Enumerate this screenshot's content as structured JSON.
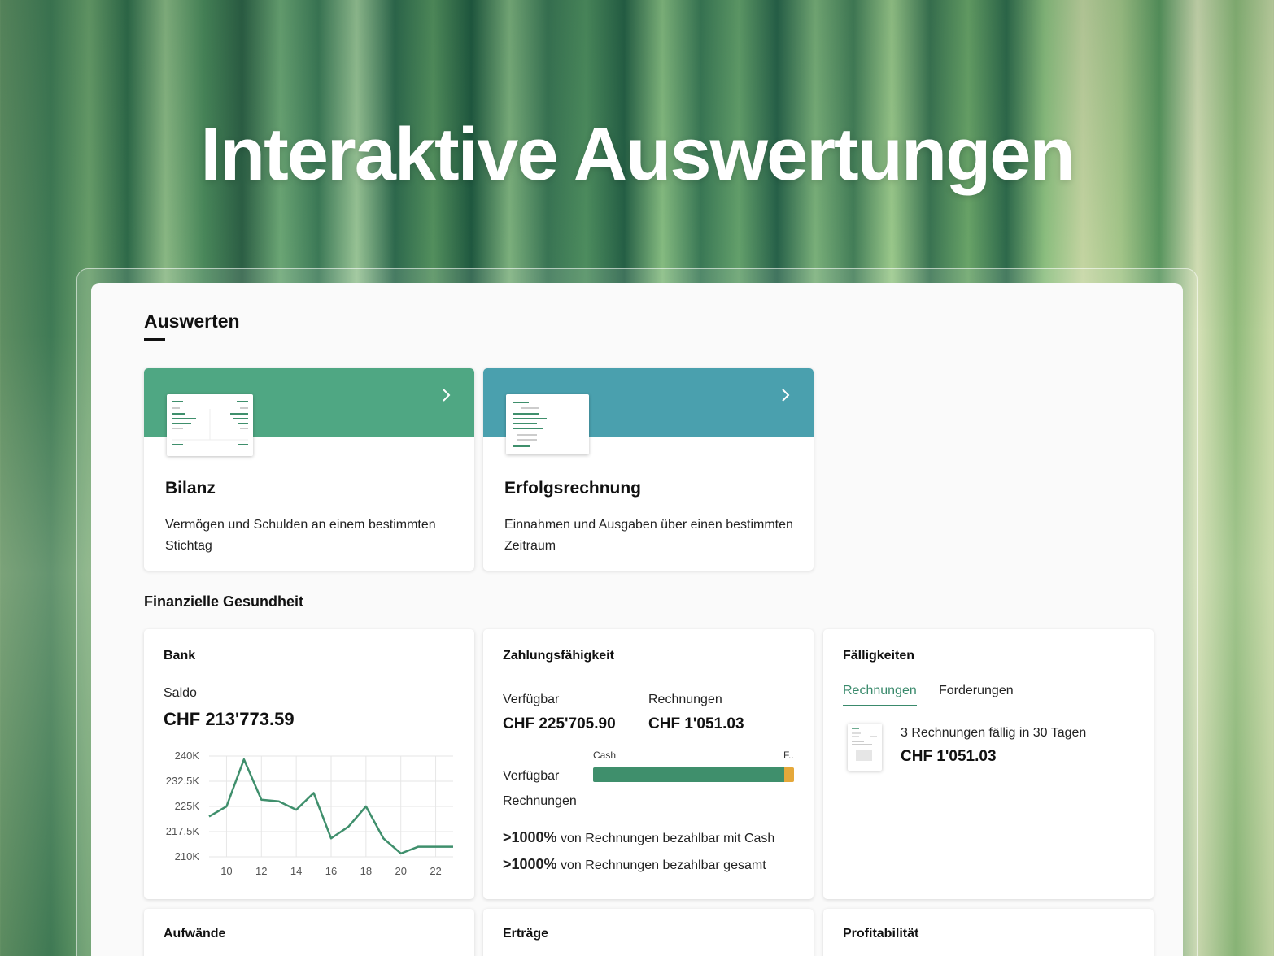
{
  "hero": {
    "title": "Interaktive Auswertungen"
  },
  "main": {
    "section_title": "Auswerten",
    "reports": [
      {
        "title": "Bilanz",
        "description": "Vermögen und Schulden an einem bestimmten Stichtag",
        "band_color": "#4fa783"
      },
      {
        "title": "Erfolgsrechnung",
        "description": "Einnahmen und Ausgaben über einen bestimmten Zeitraum",
        "band_color": "#4aa0ae"
      }
    ],
    "health_title": "Finanzielle Gesundheit"
  },
  "bank": {
    "title": "Bank",
    "saldo_label": "Saldo",
    "saldo_value": "CHF 213'773.59"
  },
  "chart_data": {
    "type": "line",
    "x": [
      9,
      10,
      11,
      12,
      13,
      14,
      15,
      16,
      17,
      18,
      19,
      20,
      21,
      22,
      23
    ],
    "values": [
      222000,
      225000,
      239000,
      227000,
      226500,
      224000,
      229000,
      215500,
      219000,
      225000,
      215500,
      211000,
      213000,
      213000,
      213000
    ],
    "xticks": [
      "10",
      "12",
      "14",
      "16",
      "18",
      "20",
      "22"
    ],
    "yticks": [
      "240K",
      "232.5K",
      "225K",
      "217.5K",
      "210K"
    ],
    "ylim": [
      210000,
      240000
    ],
    "xlim": [
      9,
      23
    ],
    "grid": true,
    "color": "#3f8f6c"
  },
  "zahlung": {
    "title": "Zahlungsfähigkeit",
    "verfuegbar_label": "Verfügbar",
    "verfuegbar_value": "CHF 225'705.90",
    "rechnungen_label": "Rechnungen",
    "rechnungen_value": "CHF 1'051.03",
    "bar_label_cash": "Cash",
    "bar_label_f": "F..",
    "row_verfuegbar": "Verfügbar",
    "row_rechnungen": "Rechnungen",
    "cash_fraction": 0.95,
    "pct1": ">1000%",
    "pct1_text": "von Rechnungen bezahlbar mit Cash",
    "pct2": ">1000%",
    "pct2_text": "von Rechnungen bezahlbar gesamt"
  },
  "faellig": {
    "title": "Fälligkeiten",
    "tabs": [
      "Rechnungen",
      "Forderungen"
    ],
    "item_text": "3 Rechnungen fällig in 30 Tagen",
    "item_value": "CHF 1'051.03"
  },
  "bottom_cards": [
    "Aufwände",
    "Erträge",
    "Profitabilität"
  ]
}
